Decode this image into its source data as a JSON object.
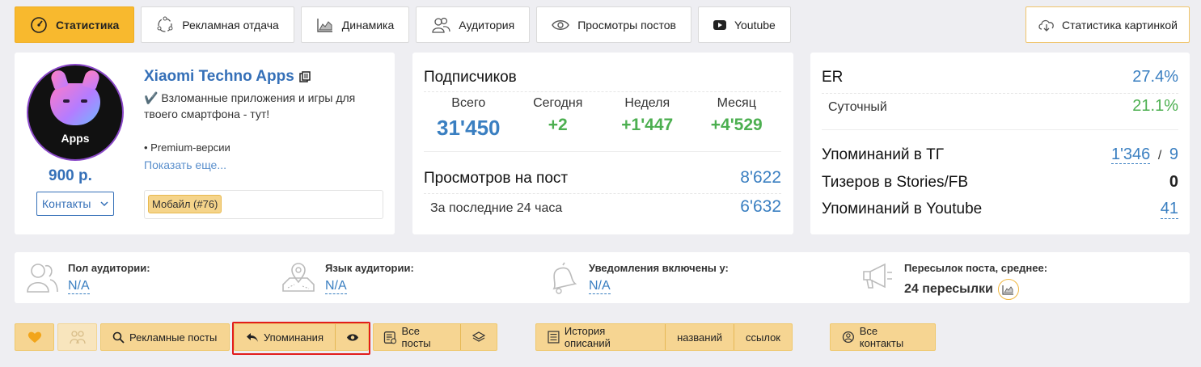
{
  "tabs": [
    {
      "label": "Статистика",
      "icon": "stats-gauge-icon",
      "active": true
    },
    {
      "label": "Рекламная отдача",
      "icon": "ad-return-icon"
    },
    {
      "label": "Динамика",
      "icon": "chart-area-icon"
    },
    {
      "label": "Аудитория",
      "icon": "users-icon"
    },
    {
      "label": "Просмотры постов",
      "icon": "eye-icon"
    },
    {
      "label": "Youtube",
      "icon": "youtube-icon"
    }
  ],
  "image_button": {
    "label": "Статистика картинкой",
    "icon": "cloud-download-icon"
  },
  "profile": {
    "avatar_text": "Apps",
    "price": "900 р.",
    "contacts_label": "Контакты",
    "name": "Xiaomi Techno Apps",
    "description": "✔️ Взломанные приложения и игры для твоего смартфона - тут!",
    "description_more": "• Premium-версии",
    "show_more": "Показать еще...",
    "tag": "Мобайл (#76)"
  },
  "subscribers": {
    "title": "Подписчиков",
    "cols": [
      {
        "label": "Всего",
        "value": "31'450"
      },
      {
        "label": "Сегодня",
        "value": "+2"
      },
      {
        "label": "Неделя",
        "value": "+1'447"
      },
      {
        "label": "Месяц",
        "value": "+4'529"
      }
    ],
    "views_label": "Просмотров на пост",
    "views_value": "8'622",
    "views24_label": "За последние 24 часа",
    "views24_value": "6'632"
  },
  "er": {
    "er_label": "ER",
    "er_value": "27.4%",
    "daily_label": "Суточный",
    "daily_value": "21.1%",
    "mentions_tg_label": "Упоминаний в ТГ",
    "mentions_tg_value": "1'346",
    "mentions_tg_sep": "/",
    "mentions_tg_value2": "9",
    "teasers_label": "Тизеров в Stories/FB",
    "teasers_value": "0",
    "mentions_yt_label": "Упоминаний в Youtube",
    "mentions_yt_value": "41"
  },
  "audience": {
    "gender_label": "Пол аудитории:",
    "gender_value": "N/A",
    "lang_label": "Язык аудитории:",
    "lang_value": "N/A",
    "notif_label": "Уведомления включены у:",
    "notif_value": "N/A",
    "forwards_label": "Пересылок поста, среднее:",
    "forwards_value": "24 пересылки"
  },
  "toolbar": {
    "ad_posts": "Рекламные посты",
    "mentions": "Упоминания",
    "all_posts": "Все посты",
    "desc_history": "История описаний",
    "names": "названий",
    "links": "ссылок",
    "all_contacts": "Все контакты"
  },
  "colors": {
    "accent": "#f8b92e",
    "link": "#3a7fc1",
    "positive": "#4caf50",
    "highlight": "#e21c1c"
  }
}
